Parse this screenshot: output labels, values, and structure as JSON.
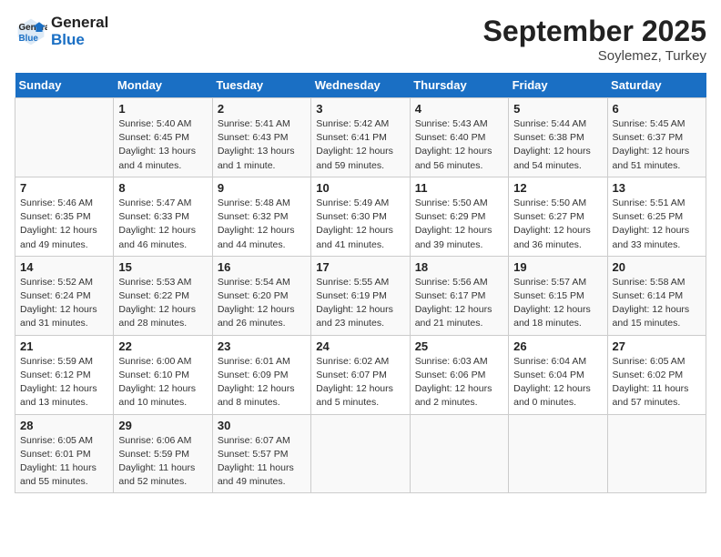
{
  "logo": {
    "line1": "General",
    "line2": "Blue"
  },
  "header": {
    "month": "September 2025",
    "location": "Soylemez, Turkey"
  },
  "days_of_week": [
    "Sunday",
    "Monday",
    "Tuesday",
    "Wednesday",
    "Thursday",
    "Friday",
    "Saturday"
  ],
  "weeks": [
    [
      {
        "day": "",
        "info": ""
      },
      {
        "day": "1",
        "info": "Sunrise: 5:40 AM\nSunset: 6:45 PM\nDaylight: 13 hours\nand 4 minutes."
      },
      {
        "day": "2",
        "info": "Sunrise: 5:41 AM\nSunset: 6:43 PM\nDaylight: 13 hours\nand 1 minute."
      },
      {
        "day": "3",
        "info": "Sunrise: 5:42 AM\nSunset: 6:41 PM\nDaylight: 12 hours\nand 59 minutes."
      },
      {
        "day": "4",
        "info": "Sunrise: 5:43 AM\nSunset: 6:40 PM\nDaylight: 12 hours\nand 56 minutes."
      },
      {
        "day": "5",
        "info": "Sunrise: 5:44 AM\nSunset: 6:38 PM\nDaylight: 12 hours\nand 54 minutes."
      },
      {
        "day": "6",
        "info": "Sunrise: 5:45 AM\nSunset: 6:37 PM\nDaylight: 12 hours\nand 51 minutes."
      }
    ],
    [
      {
        "day": "7",
        "info": "Sunrise: 5:46 AM\nSunset: 6:35 PM\nDaylight: 12 hours\nand 49 minutes."
      },
      {
        "day": "8",
        "info": "Sunrise: 5:47 AM\nSunset: 6:33 PM\nDaylight: 12 hours\nand 46 minutes."
      },
      {
        "day": "9",
        "info": "Sunrise: 5:48 AM\nSunset: 6:32 PM\nDaylight: 12 hours\nand 44 minutes."
      },
      {
        "day": "10",
        "info": "Sunrise: 5:49 AM\nSunset: 6:30 PM\nDaylight: 12 hours\nand 41 minutes."
      },
      {
        "day": "11",
        "info": "Sunrise: 5:50 AM\nSunset: 6:29 PM\nDaylight: 12 hours\nand 39 minutes."
      },
      {
        "day": "12",
        "info": "Sunrise: 5:50 AM\nSunset: 6:27 PM\nDaylight: 12 hours\nand 36 minutes."
      },
      {
        "day": "13",
        "info": "Sunrise: 5:51 AM\nSunset: 6:25 PM\nDaylight: 12 hours\nand 33 minutes."
      }
    ],
    [
      {
        "day": "14",
        "info": "Sunrise: 5:52 AM\nSunset: 6:24 PM\nDaylight: 12 hours\nand 31 minutes."
      },
      {
        "day": "15",
        "info": "Sunrise: 5:53 AM\nSunset: 6:22 PM\nDaylight: 12 hours\nand 28 minutes."
      },
      {
        "day": "16",
        "info": "Sunrise: 5:54 AM\nSunset: 6:20 PM\nDaylight: 12 hours\nand 26 minutes."
      },
      {
        "day": "17",
        "info": "Sunrise: 5:55 AM\nSunset: 6:19 PM\nDaylight: 12 hours\nand 23 minutes."
      },
      {
        "day": "18",
        "info": "Sunrise: 5:56 AM\nSunset: 6:17 PM\nDaylight: 12 hours\nand 21 minutes."
      },
      {
        "day": "19",
        "info": "Sunrise: 5:57 AM\nSunset: 6:15 PM\nDaylight: 12 hours\nand 18 minutes."
      },
      {
        "day": "20",
        "info": "Sunrise: 5:58 AM\nSunset: 6:14 PM\nDaylight: 12 hours\nand 15 minutes."
      }
    ],
    [
      {
        "day": "21",
        "info": "Sunrise: 5:59 AM\nSunset: 6:12 PM\nDaylight: 12 hours\nand 13 minutes."
      },
      {
        "day": "22",
        "info": "Sunrise: 6:00 AM\nSunset: 6:10 PM\nDaylight: 12 hours\nand 10 minutes."
      },
      {
        "day": "23",
        "info": "Sunrise: 6:01 AM\nSunset: 6:09 PM\nDaylight: 12 hours\nand 8 minutes."
      },
      {
        "day": "24",
        "info": "Sunrise: 6:02 AM\nSunset: 6:07 PM\nDaylight: 12 hours\nand 5 minutes."
      },
      {
        "day": "25",
        "info": "Sunrise: 6:03 AM\nSunset: 6:06 PM\nDaylight: 12 hours\nand 2 minutes."
      },
      {
        "day": "26",
        "info": "Sunrise: 6:04 AM\nSunset: 6:04 PM\nDaylight: 12 hours\nand 0 minutes."
      },
      {
        "day": "27",
        "info": "Sunrise: 6:05 AM\nSunset: 6:02 PM\nDaylight: 11 hours\nand 57 minutes."
      }
    ],
    [
      {
        "day": "28",
        "info": "Sunrise: 6:05 AM\nSunset: 6:01 PM\nDaylight: 11 hours\nand 55 minutes."
      },
      {
        "day": "29",
        "info": "Sunrise: 6:06 AM\nSunset: 5:59 PM\nDaylight: 11 hours\nand 52 minutes."
      },
      {
        "day": "30",
        "info": "Sunrise: 6:07 AM\nSunset: 5:57 PM\nDaylight: 11 hours\nand 49 minutes."
      },
      {
        "day": "",
        "info": ""
      },
      {
        "day": "",
        "info": ""
      },
      {
        "day": "",
        "info": ""
      },
      {
        "day": "",
        "info": ""
      }
    ]
  ]
}
